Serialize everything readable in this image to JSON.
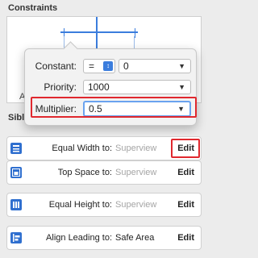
{
  "section": {
    "title": "Constraints"
  },
  "background_labels": {
    "peek_a": "A",
    "siblings_prefix": "Sibl"
  },
  "popover": {
    "constant": {
      "label": "Constant:",
      "relation": "=",
      "value": "0"
    },
    "priority": {
      "label": "Priority:",
      "value": "1000"
    },
    "multiplier": {
      "label": "Multiplier:",
      "value": "0.5"
    }
  },
  "constraints": [
    {
      "label": "Equal Width to:",
      "target": "Superview",
      "edit": "Edit",
      "icon": "equal-width-icon"
    },
    {
      "label": "Top Space to:",
      "target": "Superview",
      "edit": "Edit",
      "icon": "top-space-icon"
    },
    {
      "label": "Equal Height to:",
      "target": "Superview",
      "edit": "Edit",
      "icon": "equal-height-icon"
    },
    {
      "label": "Align Leading to:",
      "target": "Safe Area",
      "edit": "Edit",
      "icon": "align-leading-icon"
    }
  ],
  "colors": {
    "accent": "#3b7ddd",
    "highlight_red": "#e0282e",
    "icon_blue": "#2f6fcf"
  }
}
